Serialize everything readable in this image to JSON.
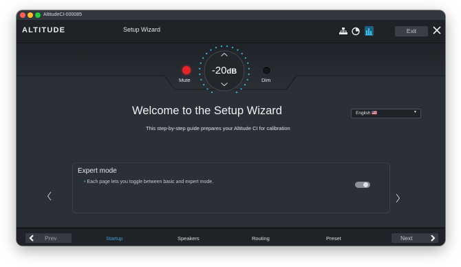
{
  "window": {
    "title": "AltitudeCI-000085"
  },
  "header": {
    "logo": "ALTITUDE",
    "title": "Setup Wizard",
    "exit_label": "Exit",
    "icons": [
      "network-icon",
      "timer-icon",
      "levels-icon"
    ]
  },
  "monitor": {
    "mute_label": "Mute",
    "dim_label": "Dim",
    "volume_value": "-20",
    "volume_unit": "dB",
    "mute_color": "#e0262b"
  },
  "welcome": {
    "heading": "Welcome to the Setup Wizard",
    "subtitle": "This step-by-step guide prepares your Altitude CI for calibration",
    "language_selected": "English 🇺🇸"
  },
  "expert": {
    "title": "Expert mode",
    "description": "Each page lets you toggle between basic and expert mode.",
    "enabled": false
  },
  "footer": {
    "prev_label": "Prev",
    "next_label": "Next",
    "tabs": [
      {
        "label": "Startup",
        "active": true
      },
      {
        "label": "Speakers",
        "active": false
      },
      {
        "label": "Routing",
        "active": false
      },
      {
        "label": "Preset",
        "active": false
      }
    ]
  },
  "colors": {
    "accent": "#3fa4d8",
    "knob_dots": "#2fc3e6"
  }
}
